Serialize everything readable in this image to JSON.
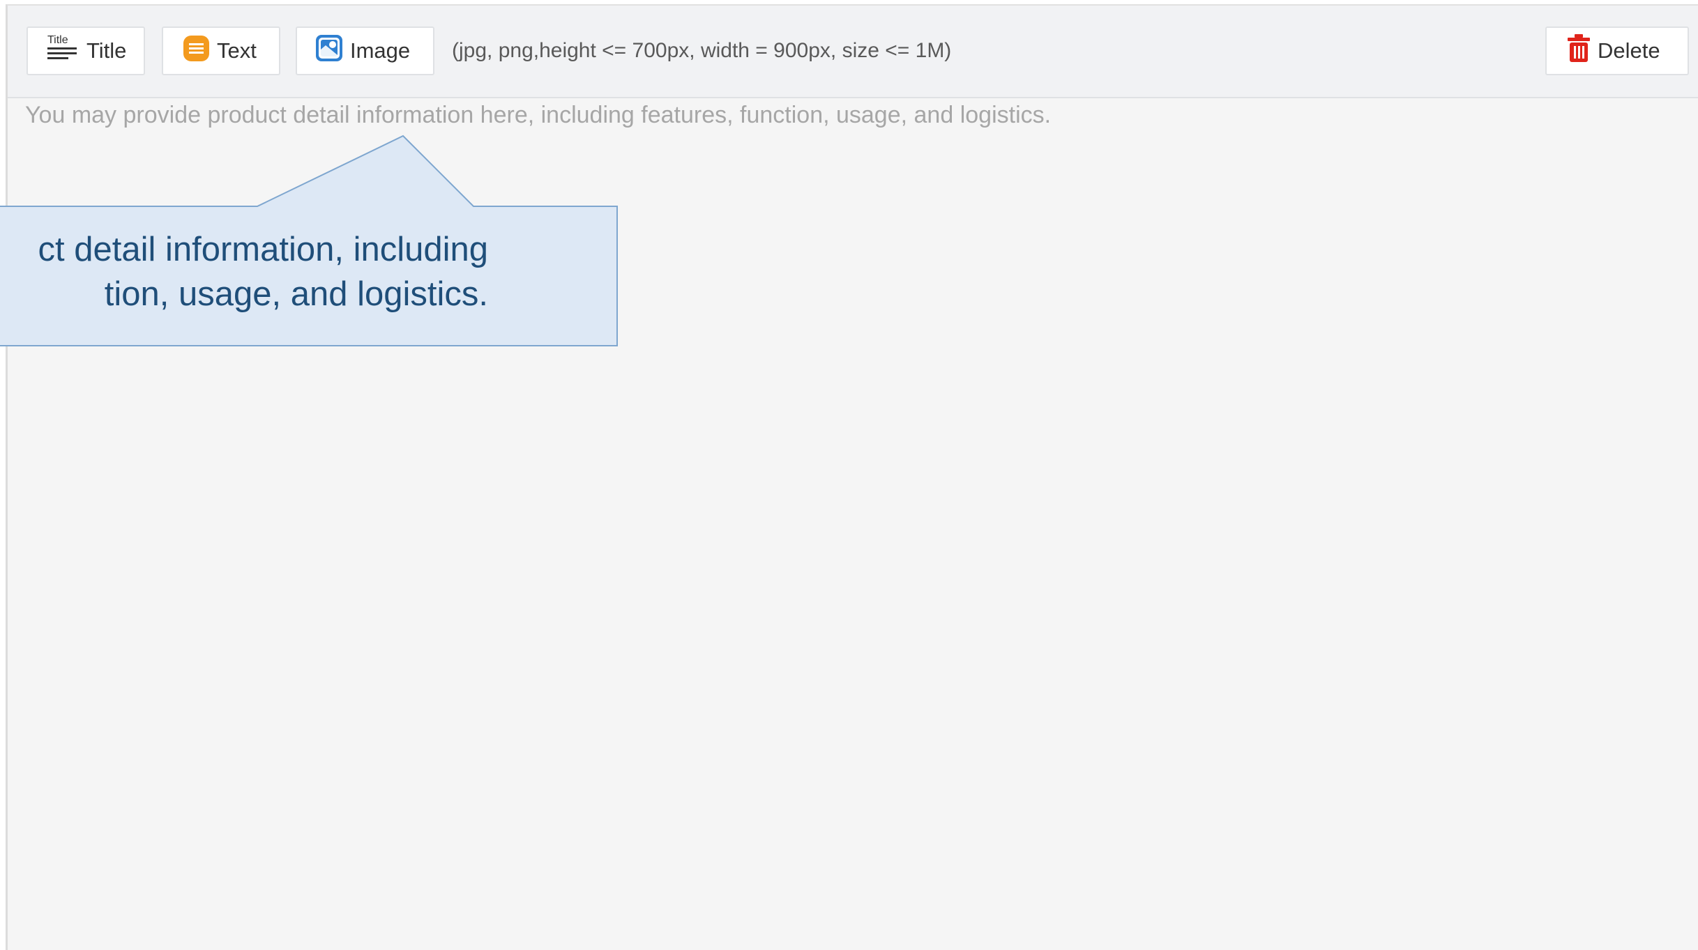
{
  "toolbar": {
    "title_label": "Title",
    "title_icon_text": "Title",
    "text_label": "Text",
    "image_label": "Image",
    "image_hint": "(jpg, png,height <= 700px, width = 900px, size <= 1M)",
    "delete_label": "Delete"
  },
  "editor": {
    "placeholder": "You may provide product detail information here, including features, function, usage, and logistics."
  },
  "callout": {
    "line1": "ct detail information, including",
    "line2": "tion, usage, and logistics."
  },
  "colors": {
    "text_icon": "#f39a1e",
    "image_icon": "#2f80d1",
    "delete_icon": "#e0241b",
    "callout_fill": "#dde8f5",
    "callout_border": "#7ea6cf"
  },
  "icons": {
    "title": "title-heading-icon",
    "text": "text-block-icon",
    "image": "picture-icon",
    "delete": "trash-icon"
  }
}
